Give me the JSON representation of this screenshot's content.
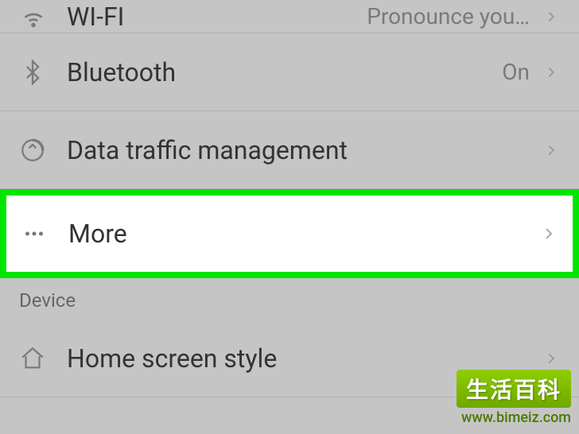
{
  "items": {
    "wifi": {
      "label": "WI-FI",
      "value": "Pronounce you…"
    },
    "bluetooth": {
      "label": "Bluetooth",
      "value": "On"
    },
    "data_traffic": {
      "label": "Data traffic management"
    },
    "more": {
      "label": "More"
    },
    "home_screen": {
      "label": "Home screen style"
    }
  },
  "sections": {
    "device": "Device"
  },
  "watermark": {
    "title": "生活百科",
    "url": "www.bimeiz.com"
  }
}
